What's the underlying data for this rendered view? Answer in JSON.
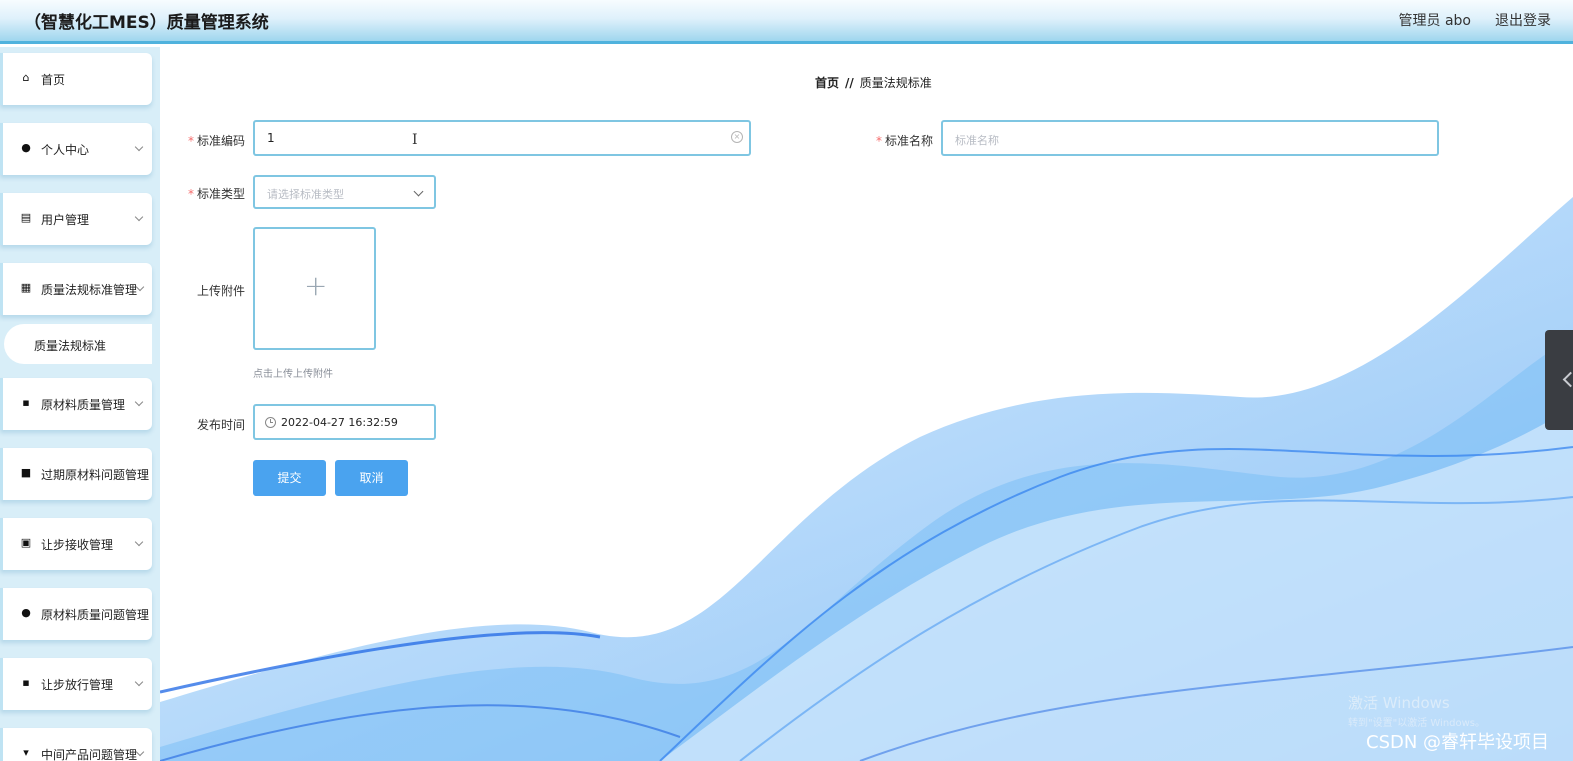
{
  "header": {
    "app_title": "（智慧化工MES）质量管理系统",
    "user_label": "管理员 abo",
    "logout_label": "退出登录"
  },
  "sidebar": {
    "items": [
      {
        "label": "首页",
        "icon": "home-icon"
      },
      {
        "label": "个人中心",
        "icon": "user-icon"
      },
      {
        "label": "用户管理",
        "icon": "clipboard-icon"
      },
      {
        "label": "质量法规标准管理",
        "icon": "grid-icon"
      },
      {
        "label": "原材料质量管理",
        "icon": "apps-icon"
      },
      {
        "label": "过期原材料问题管理",
        "icon": "briefcase-icon"
      },
      {
        "label": "让步接收管理",
        "icon": "clipboard-check-icon"
      },
      {
        "label": "原材料质量问题管理",
        "icon": "pin-icon"
      },
      {
        "label": "让步放行管理",
        "icon": "apps-icon"
      },
      {
        "label": "中间产品问题管理",
        "icon": "cup-icon"
      }
    ],
    "active_sub": "质量法规标准"
  },
  "breadcrumb": {
    "home": "首页",
    "separator": "//",
    "current": "质量法规标准"
  },
  "form": {
    "code": {
      "label": "标准编码",
      "value": "1"
    },
    "name": {
      "label": "标准名称",
      "placeholder": "标准名称"
    },
    "type": {
      "label": "标准类型",
      "placeholder": "请选择标准类型"
    },
    "attachment": {
      "label": "上传附件",
      "hint": "点击上传上传附件"
    },
    "publish_time": {
      "label": "发布时间",
      "value": "2022-04-27 16:32:59"
    },
    "submit_label": "提交",
    "cancel_label": "取消"
  },
  "watermarks": {
    "windows_line1": "激活 Windows",
    "windows_line2": "转到\"设置\"以激活 Windows。",
    "csdn": "CSDN @睿轩毕设项目"
  },
  "colors": {
    "accent": "#4aa3ef",
    "input_border": "#7fc6e2",
    "required": "#f56c6c",
    "sidebar_bg": "#d8eef8"
  }
}
